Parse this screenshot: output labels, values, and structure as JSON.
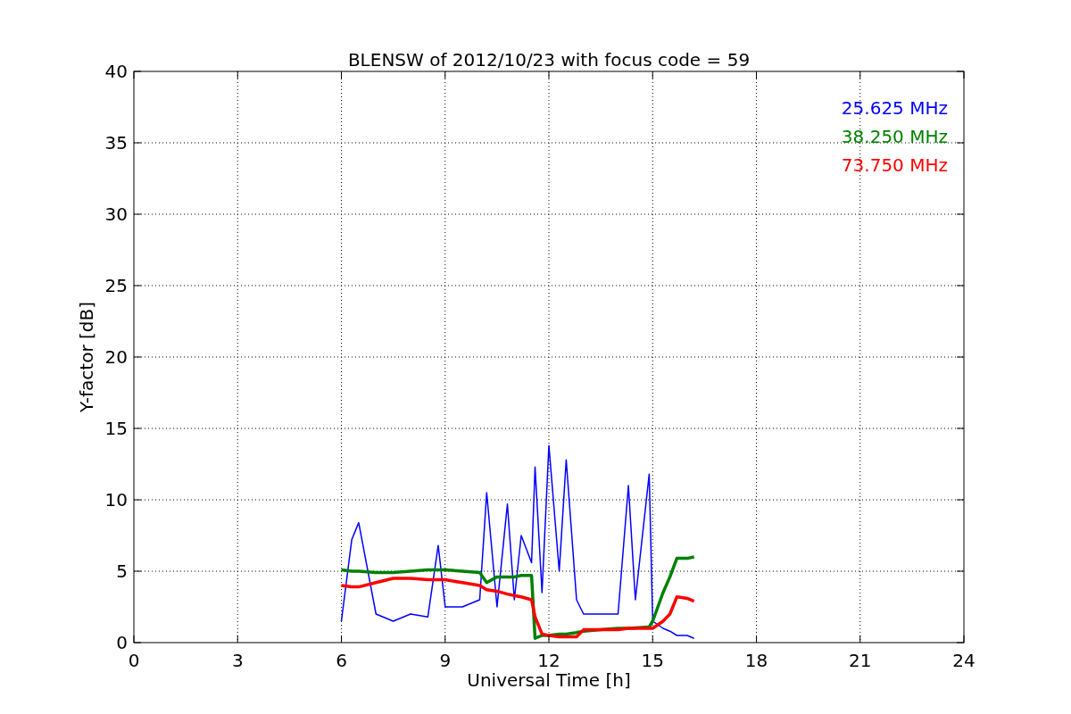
{
  "chart_data": {
    "type": "line",
    "title": "BLENSW of 2012/10/23 with focus code = 59",
    "xlabel": "Universal Time [h]",
    "ylabel": "Y-factor [dB]",
    "x": [
      6,
      6.3,
      6.5,
      7,
      7.5,
      8,
      8.5,
      8.8,
      9,
      9.5,
      10,
      10.2,
      10.5,
      10.8,
      11,
      11.2,
      11.5,
      11.6,
      11.8,
      12,
      12.3,
      12.5,
      12.8,
      13,
      13.5,
      14,
      14.3,
      14.5,
      14.9,
      15,
      15.3,
      15.5,
      15.7,
      16,
      16.2
    ],
    "series": [
      {
        "name": "25.625 MHz",
        "color": "#0000ff",
        "values": [
          1.5,
          7.2,
          8.4,
          2.0,
          1.5,
          2.0,
          1.8,
          6.8,
          2.5,
          2.5,
          3.0,
          10.5,
          2.5,
          9.7,
          3.0,
          7.5,
          5.6,
          12.3,
          3.5,
          13.8,
          5.0,
          12.8,
          3.0,
          2.0,
          2.0,
          2.0,
          11.0,
          3.0,
          11.8,
          1.5,
          1.0,
          0.8,
          0.5,
          0.5,
          0.3
        ]
      },
      {
        "name": "38.250 MHz",
        "color": "#008000",
        "values": [
          5.1,
          5.0,
          5.0,
          4.9,
          4.9,
          5.0,
          5.1,
          5.1,
          5.1,
          5.0,
          4.9,
          4.2,
          4.6,
          4.6,
          4.6,
          4.7,
          4.7,
          0.3,
          0.5,
          0.5,
          0.6,
          0.6,
          0.7,
          0.8,
          0.9,
          1.0,
          1.0,
          null,
          1.1,
          1.5,
          3.5,
          4.6,
          5.9,
          5.9,
          6.0
        ]
      },
      {
        "name": "73.750 MHz",
        "color": "#ff0000",
        "values": [
          4.0,
          3.9,
          3.9,
          4.2,
          4.5,
          4.5,
          4.4,
          4.4,
          4.4,
          4.2,
          4.0,
          3.7,
          3.6,
          3.4,
          3.3,
          3.2,
          3.0,
          1.8,
          0.6,
          0.5,
          0.4,
          0.4,
          0.4,
          0.9,
          0.9,
          0.9,
          1.0,
          1.0,
          1.0,
          1.0,
          1.5,
          2.0,
          3.2,
          3.1,
          2.9
        ]
      }
    ],
    "grid": true,
    "xlim": [
      0,
      24
    ],
    "ylim": [
      0,
      40
    ],
    "xticks": [
      0,
      3,
      6,
      9,
      12,
      15,
      18,
      21,
      24
    ],
    "yticks": [
      0,
      5,
      10,
      15,
      20,
      25,
      30,
      35,
      40
    ]
  }
}
